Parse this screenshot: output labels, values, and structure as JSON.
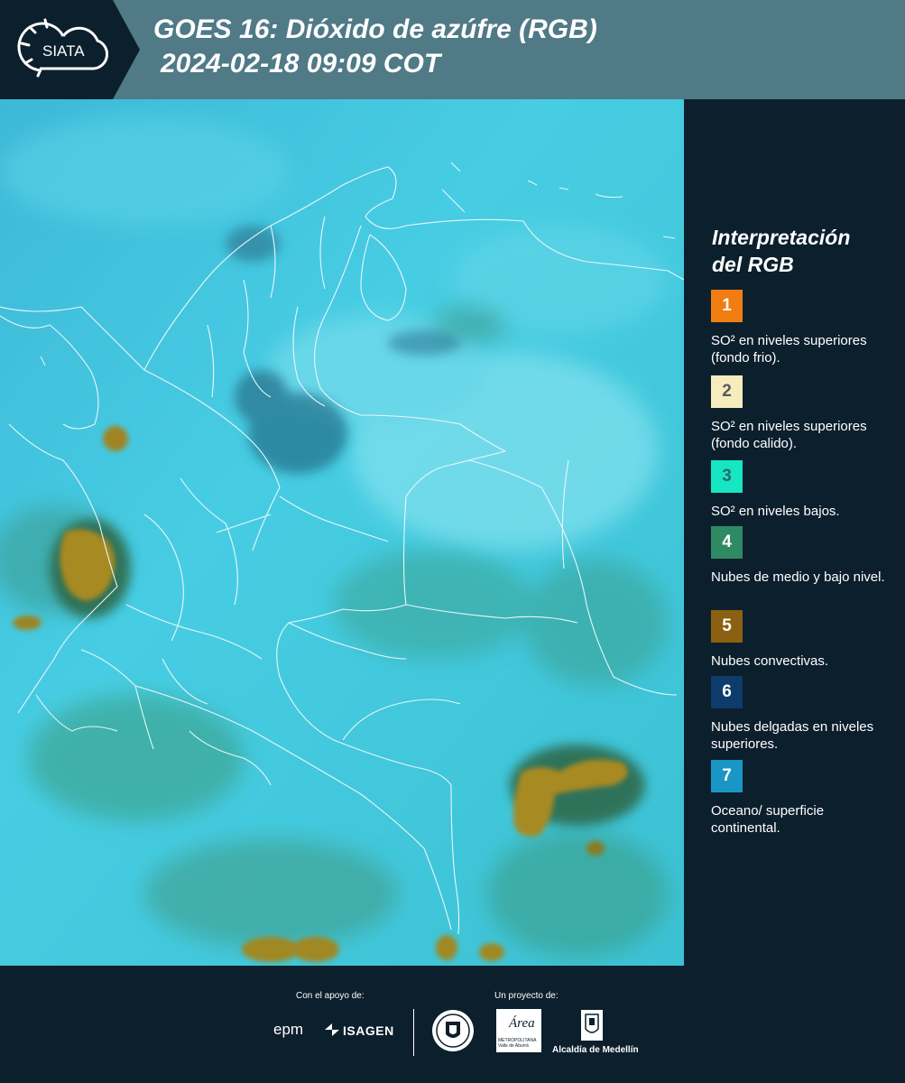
{
  "header": {
    "logo_text": "SIATA",
    "title_line1": "GOES 16: Dióxido de azúfre (RGB)",
    "title_line2": "2024-02-18 09:09 COT"
  },
  "legend": {
    "title_line1": "Interpretación",
    "title_line2": "del RGB",
    "items": [
      {
        "number": "1",
        "color": "#f07d12",
        "text": "SO² en niveles superiores (fondo frio)."
      },
      {
        "number": "2",
        "color": "#f6edbe",
        "text": "SO² en niveles superiores (fondo calido)."
      },
      {
        "number": "3",
        "color": "#16e6c2",
        "text": "SO² en niveles bajos."
      },
      {
        "number": "4",
        "color": "#2f8a64",
        "text": "Nubes de medio y bajo nivel."
      },
      {
        "number": "5",
        "color": "#8c6011",
        "text": "Nubes convectivas."
      },
      {
        "number": "6",
        "color": "#0d3b6b",
        "text": "Nubes delgadas en niveles superiores."
      },
      {
        "number": "7",
        "color": "#1a96c6",
        "text": "Oceano/ superficie continental."
      }
    ]
  },
  "footer": {
    "support_label": "Con el apoyo de:",
    "project_label": "Un proyecto de:",
    "sponsor_epm": "epm",
    "sponsor_isagen": "ISAGEN",
    "area_name": "Área",
    "area_caption_1": "METROPOLITANA",
    "area_caption_2": "Valle de Aburrá",
    "medellin_name": "Alcaldía de Medellín"
  },
  "colors": {
    "header_bg": "#4f7a86",
    "panel_bg": "#0c1f2d",
    "map_base": "#3cc6dc",
    "cloud_convective": "#8c6a17"
  }
}
